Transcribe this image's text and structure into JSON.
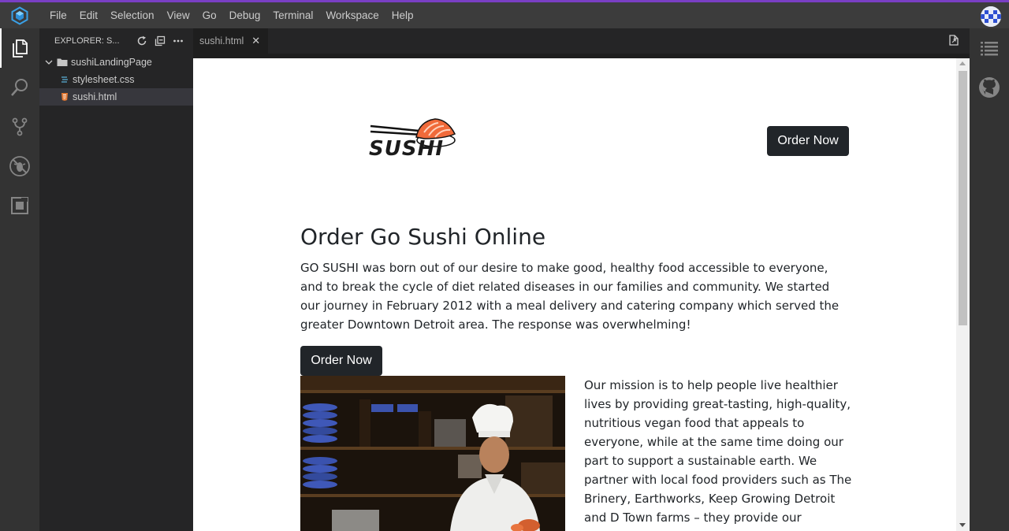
{
  "menubar": {
    "items": [
      "File",
      "Edit",
      "Selection",
      "View",
      "Go",
      "Debug",
      "Terminal",
      "Workspace",
      "Help"
    ]
  },
  "activity_bar": {
    "icons": [
      "files-icon",
      "search-icon",
      "source-control-icon",
      "debug-icon",
      "extensions-icon"
    ]
  },
  "explorer": {
    "title": "EXPLORER: S...",
    "folder": "sushiLandingPage",
    "files": [
      "stylesheet.css",
      "sushi.html"
    ],
    "selected_file": "sushi.html"
  },
  "editor": {
    "tab_label": "sushi.html"
  },
  "preview": {
    "logo_text": "SUSHI",
    "nav_button": "Order Now",
    "heading": "Order Go Sushi Online",
    "intro": "GO SUSHI was born out of our desire to make good, healthy food accessible to everyone, and to break the cycle of diet related diseases in our families and community. We started our journey in February 2012 with a meal delivery and catering company which served the greater Downtown Detroit area. The response was overwhelming!",
    "cta_button": "Order Now",
    "mission": "Our mission is to help people live healthier lives by providing great-tasting, high-quality, nutritious vegan food that appeals to everyone, while at the same time doing our part to support a sustainable earth. We partner with local food providers such as The Brinery, Earthworks, Keep Growing Detroit and D Town farms – they provide our seasonal organic"
  },
  "colors": {
    "accent_top": "#7a3fc4",
    "menubar_bg": "#3c3c3c",
    "activity_bg": "#333333",
    "sidebar_bg": "#252526",
    "editor_bg": "#1e1e1e",
    "button_dark": "#212529",
    "logo_salmon": "#f06a3a"
  }
}
